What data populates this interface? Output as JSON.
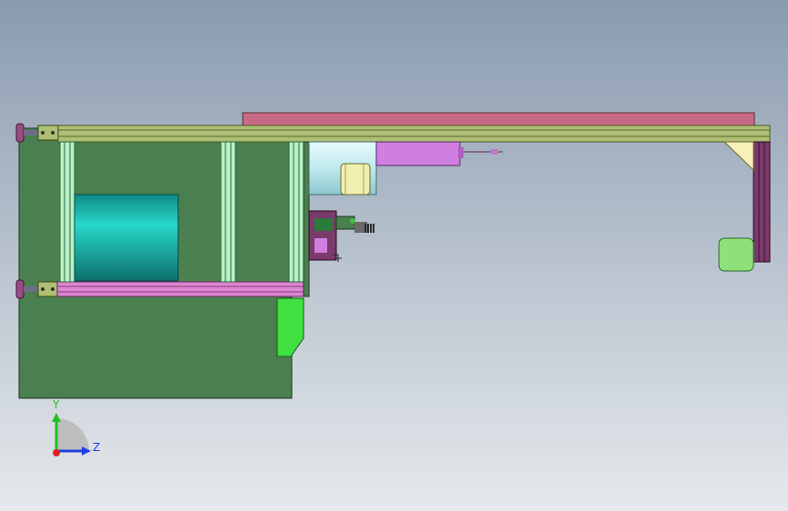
{
  "viewport": {
    "background_top": "#8a9bb0",
    "background_bottom": "#e6e9ec"
  },
  "colors": {
    "base_plate": "#4a7f4f",
    "rail_olive": "#aebf75",
    "rail_pink": "#dc86d0",
    "top_plate": "#c86a86",
    "cylinder": "#1fc4b8",
    "upright": "#b8f0c8",
    "motor_body": "#cfeff2",
    "motor_yellow": "#f2f0b0",
    "box_magenta": "#d07ee0",
    "pad_green": "#8fe07a",
    "column_purple": "#7a3a6a",
    "bracket_yellow": "#f5f1b8",
    "bracket_lime": "#40e040",
    "foot": "#9a4b86"
  },
  "triad": {
    "y_label": "Y",
    "z_label": "Z",
    "y_color": "#20c020",
    "z_color": "#2040e0",
    "x_color": "#e02020"
  }
}
